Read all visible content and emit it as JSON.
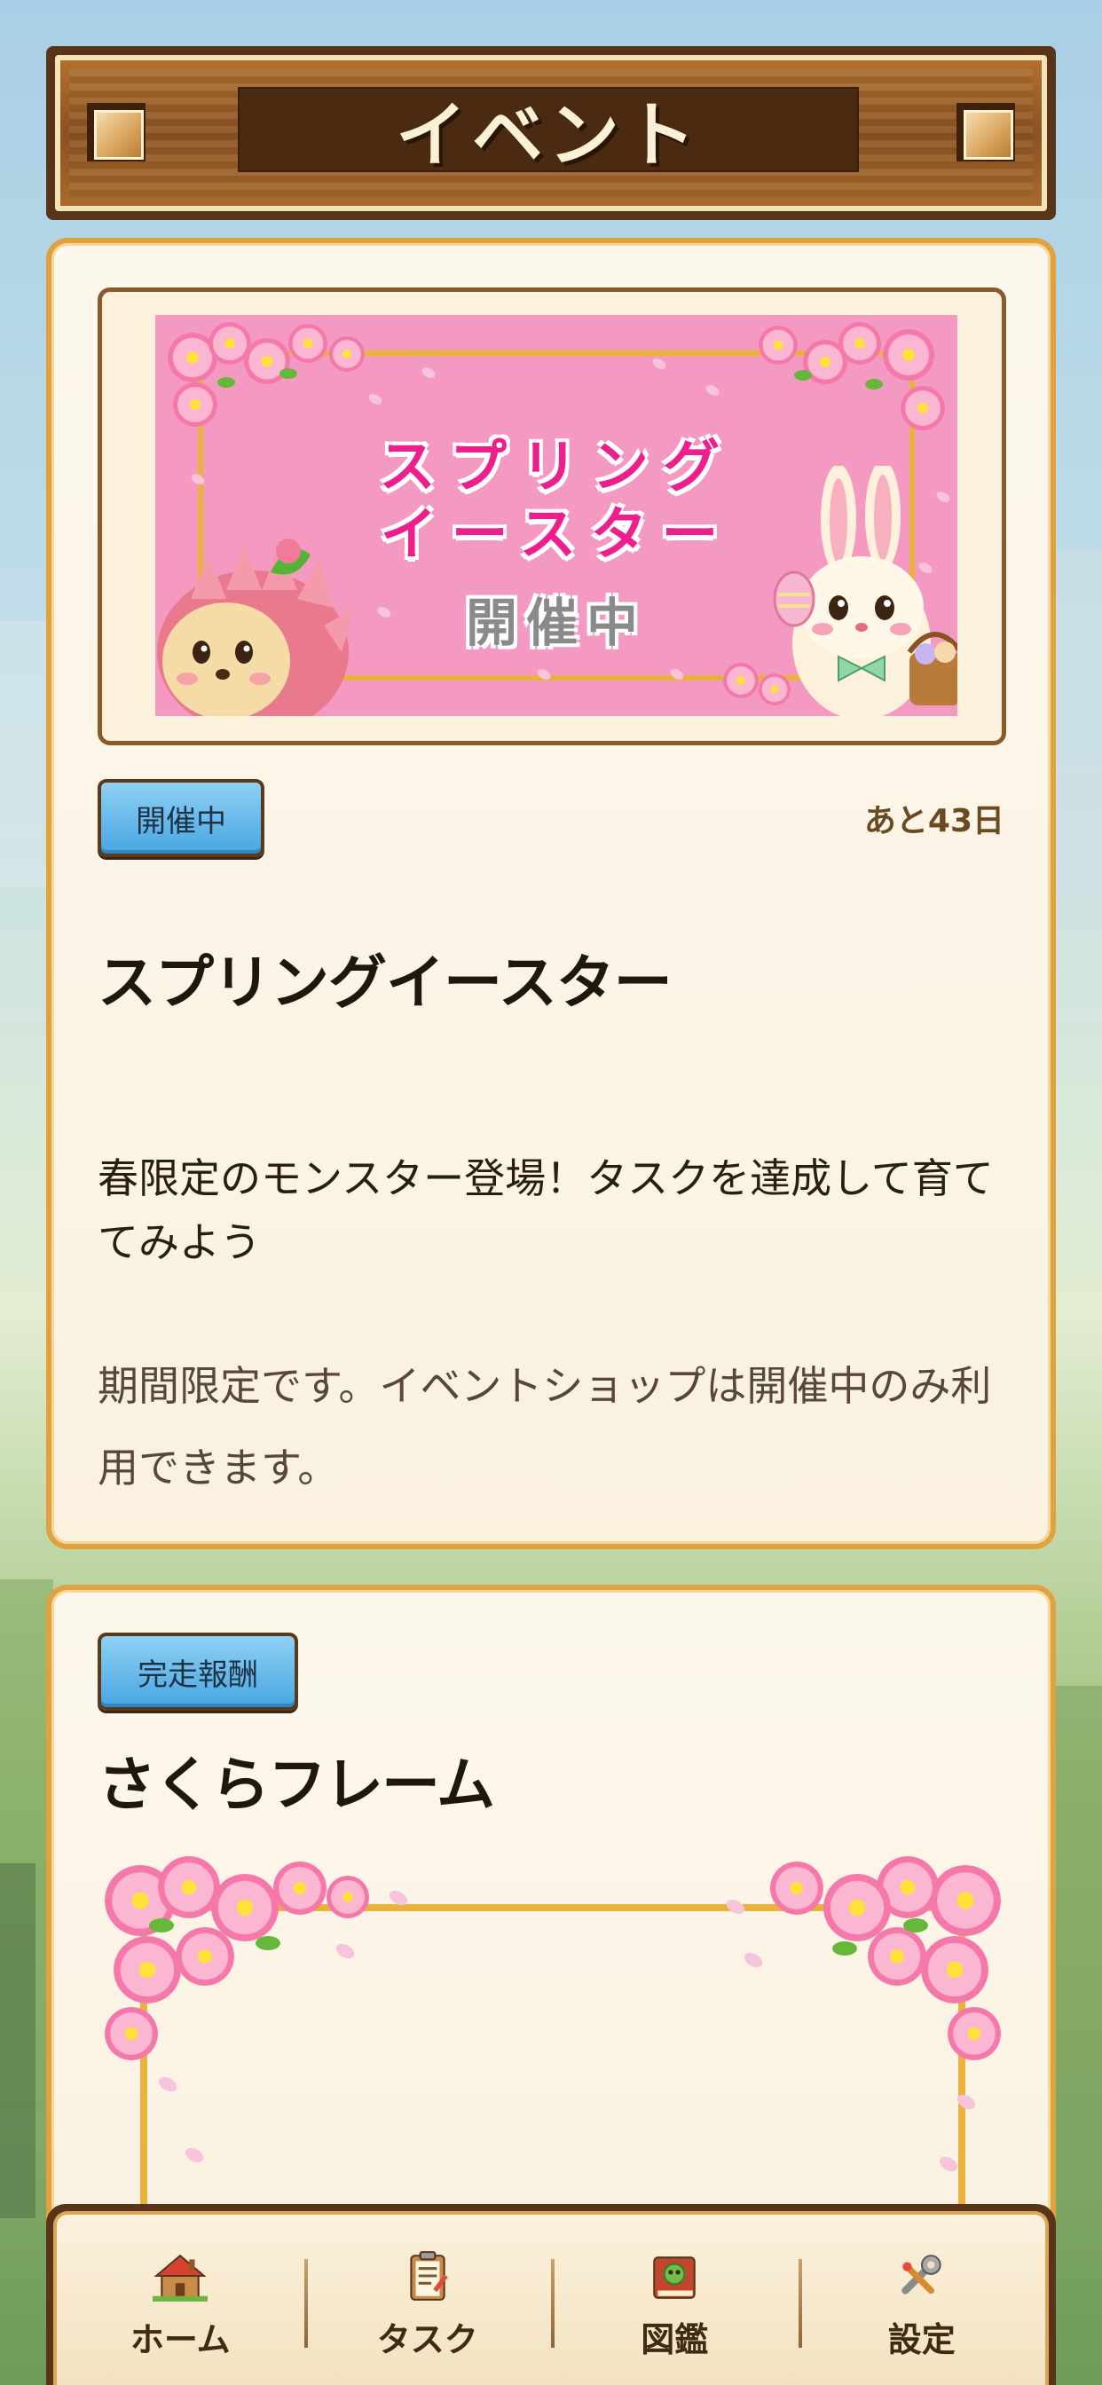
{
  "header": {
    "title": "イベント"
  },
  "event": {
    "banner_title_line1": "スプリング",
    "banner_title_line2": "イースター",
    "banner_status": "開催中",
    "status_badge": "開催中",
    "days_left": "あと43日",
    "title": "スプリングイースター",
    "description": "春限定のモンスター登場！タスクを達成して育ててみよう",
    "note": "期間限定です。イベントショップは開催中のみ利用できます。"
  },
  "reward": {
    "badge": "完走報酬",
    "title": "さくらフレーム"
  },
  "bottom_nav": {
    "items": [
      {
        "label": "ホーム",
        "icon": "house-icon"
      },
      {
        "label": "タスク",
        "icon": "clipboard-icon"
      },
      {
        "label": "図鑑",
        "icon": "book-icon"
      },
      {
        "label": "設定",
        "icon": "wrench-icon"
      }
    ]
  },
  "colors": {
    "accent_border": "#e0a13f",
    "badge_blue": "#47a6e0",
    "banner_pink": "#f49ac2",
    "banner_text_pink": "#ee1e8c",
    "wood_brown": "#5a3418"
  }
}
